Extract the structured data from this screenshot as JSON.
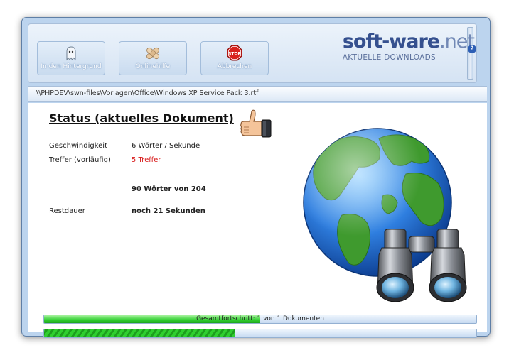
{
  "toolbar": {
    "buttons": [
      {
        "label": "In den Hintergrund",
        "icon": "ghost-icon"
      },
      {
        "label": "Onlinehilfe",
        "icon": "bandage-icon"
      },
      {
        "label": "Abbrechen",
        "icon": "stop-sign-icon"
      }
    ]
  },
  "path": "\\\\PHPDEV\\swn-files\\Vorlagen\\Office\\Windows XP Service Pack 3.rtf",
  "status": {
    "title": "Status (aktuelles Dokument)",
    "speed_label": "Geschwindigkeit",
    "speed_value": "6 Wörter / Sekunde",
    "hits_label": "Treffer (vorläufig)",
    "hits_value": "5 Treffer",
    "words_progress": "90 Wörter von 204",
    "remaining_label": "Restdauer",
    "remaining_value": "noch 21 Sekunden"
  },
  "progress": {
    "overall_text": "Gesamtfortschritt: 1 von 1 Dokumenten",
    "overall_fraction": 0.5,
    "document_fraction": 0.44
  },
  "watermark": {
    "brand": "soft-ware",
    "tld": ".net",
    "tagline": "AKTUELLE DOWNLOADS"
  },
  "colors": {
    "accent": "#35508f",
    "progress_green": "#2fcf2f",
    "hits_red": "#d81a1a"
  }
}
